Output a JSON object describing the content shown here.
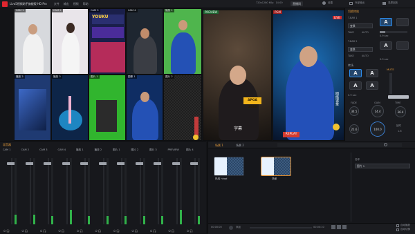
{
  "titlebar": {
    "app_title": "Livo5视频助手旗舰版 HD Pro",
    "menu": [
      "文件",
      "输出",
      "视频",
      "帮助"
    ],
    "resolution": "720x1280 60p",
    "time": "14:00",
    "btn_live": "直播间",
    "btn_settings": "设置",
    "btn_output": "外部输出",
    "btn_record": "录屏回放"
  },
  "grid": {
    "labels": [
      "CAM 1",
      "CAM 2",
      "CAM 3",
      "CAM 4",
      "播放 1",
      "播放 2",
      "播放 3",
      "图片 1",
      "图像 1",
      "图片 2",
      "图片 3",
      "图片 4"
    ]
  },
  "preview": {
    "label": "PREVIEW",
    "overlay_text": "APGA 2014",
    "caption_line": "字幕"
  },
  "program": {
    "label": "PGM",
    "live": "LIVE",
    "overlay_right": "网络课堂",
    "replay": "REPLAY"
  },
  "right_panel": {
    "tab": "切换特效",
    "row1_label": "T-BAR 1",
    "row1_value": "A",
    "row1_select": "变换",
    "row2_label": "T-BAR 2",
    "row2_value": "A",
    "row2_select": "变换",
    "take_label": "TAKE",
    "auto_label": "AUTO",
    "time1": "0.9 sec",
    "time2": "0.9 sec",
    "section2": "转场",
    "big_btns": [
      "A",
      "A",
      "A",
      "A",
      "A",
      "A"
    ],
    "time3": "0.9 sec",
    "time4": "0.9 sec",
    "knob_labels": [
      "FADE",
      "GAIN",
      "TIME"
    ],
    "knob_values": [
      "34.5",
      "14.4",
      "36.4",
      "21.6",
      "100.0"
    ],
    "mute": "MUTE",
    "delay": "延时",
    "delay_val": "1.6"
  },
  "mixer": {
    "tab": "混音器",
    "channels": [
      {
        "name": "CAM 1",
        "level": 0.15
      },
      {
        "name": "CAM 2",
        "level": 0.15
      },
      {
        "name": "CAM 3",
        "level": 0.12
      },
      {
        "name": "CAM 4",
        "level": 0.22
      },
      {
        "name": "播放 1",
        "level": 0.12
      },
      {
        "name": "播放 2",
        "level": 0.12
      },
      {
        "name": "图片 1",
        "level": 0.12
      },
      {
        "name": "图片 2",
        "level": 0.12
      },
      {
        "name": "图片 3",
        "level": 0.12
      },
      {
        "name": "PREVIEW",
        "level": 0.22
      },
      {
        "name": "图片 4",
        "level": 0.12
      }
    ],
    "scale": [
      "0",
      "-5",
      "-10",
      "-15",
      "-20",
      "-30",
      "-40",
      "-50",
      "-60"
    ]
  },
  "playlist": {
    "tab1": "场景 1",
    "tab2": "场景 2",
    "items": [
      {
        "label": "热线 hhqd"
      },
      {
        "label": "场景"
      }
    ],
    "right_title": "名称",
    "right_select": "图片 1",
    "footer_left": "00:00:00",
    "footer_right": "00:00:10",
    "footer_btn": "添加",
    "checkbox1": "自动播放",
    "checkbox2": "自动切换"
  }
}
